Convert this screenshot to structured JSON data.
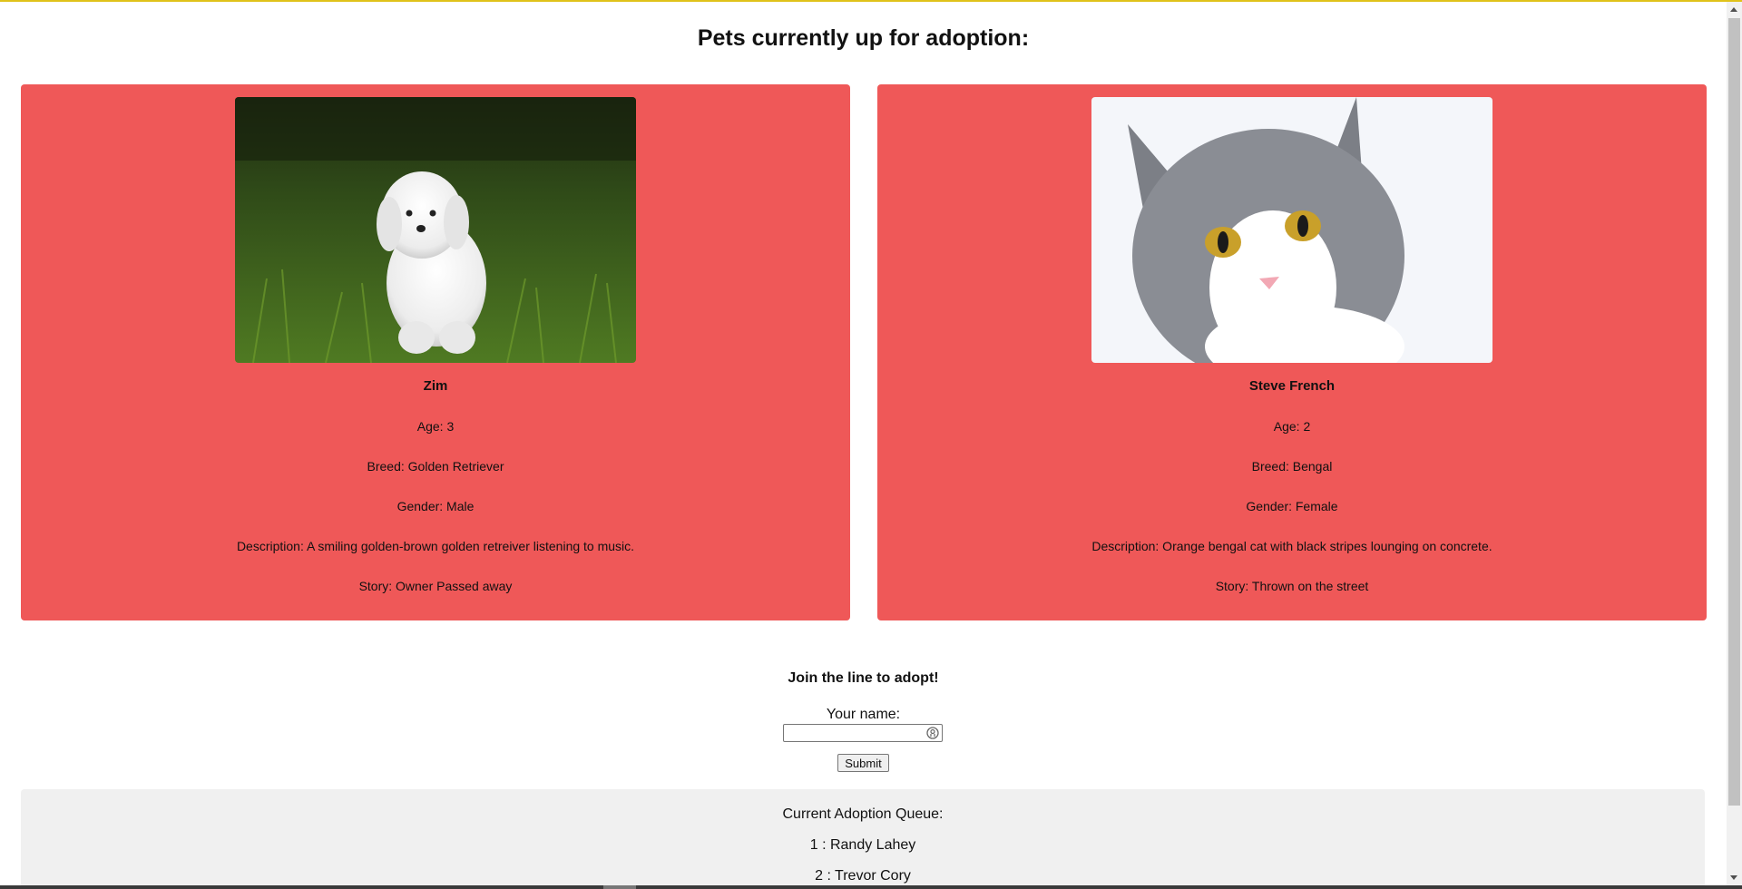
{
  "page": {
    "title": "Pets currently up for adoption:"
  },
  "pets": [
    {
      "image": "white-dog-in-grass-photo",
      "name": "Zim",
      "age": "Age: 3",
      "breed": "Breed: Golden Retriever",
      "gender": "Gender: Male",
      "description": "Description: A smiling golden-brown golden retreiver listening to music.",
      "story": "Story: Owner Passed away"
    },
    {
      "image": "gray-white-cat-photo",
      "name": "Steve French",
      "age": "Age: 2",
      "breed": "Breed: Bengal",
      "gender": "Gender: Female",
      "description": "Description: Orange bengal cat with black stripes lounging on concrete.",
      "story": "Story: Thrown on the street"
    }
  ],
  "join": {
    "title": "Join the line to adopt!",
    "name_label": "Your name:",
    "name_value": "",
    "name_icon": "key-icon",
    "submit_label": "Submit"
  },
  "queue": {
    "title": "Current Adoption Queue:",
    "items": [
      "1 : Randy Lahey",
      "2 : Trevor Cory"
    ]
  },
  "colors": {
    "card_bg": "#ef5858",
    "queue_bg": "#f0f0f0",
    "top_accent": "#e0c21a"
  }
}
